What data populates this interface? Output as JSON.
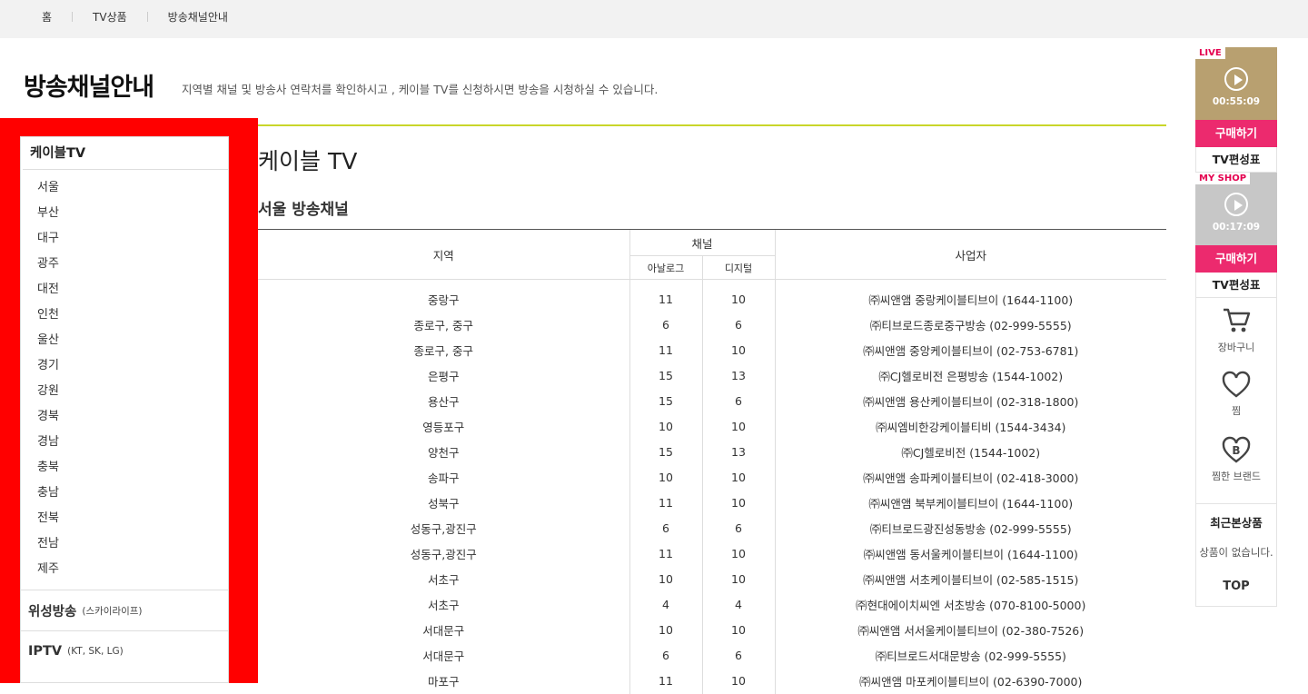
{
  "breadcrumb": [
    "홈",
    "TV상품",
    "방송채널안내"
  ],
  "page": {
    "title": "방송채널안내",
    "description": "지역별 채널 및 방송사 연락처를 확인하시고 , 케이블 TV를 신청하시면 방송을 시청하실 수 있습니다.",
    "main_heading": "케이블 TV",
    "sub_heading": "서울 방송채널"
  },
  "left_nav": {
    "cable_title": "케이블TV",
    "regions": [
      "서울",
      "부산",
      "대구",
      "광주",
      "대전",
      "인천",
      "울산",
      "경기",
      "강원",
      "경북",
      "경남",
      "충북",
      "충남",
      "전북",
      "전남",
      "제주"
    ],
    "satellite": {
      "label": "위성방송",
      "sub": "(스카이라이프)"
    },
    "iptv": {
      "label": "IPTV",
      "sub": "(KT, SK, LG)"
    }
  },
  "table": {
    "headers": {
      "region": "지역",
      "channel": "채널",
      "analog": "아날로그",
      "digital": "디지털",
      "operator": "사업자"
    },
    "rows": [
      [
        "중랑구",
        "11",
        "10",
        "㈜씨앤앰 중랑케이블티브이 (1644-1100)"
      ],
      [
        "종로구, 중구",
        "6",
        "6",
        "㈜티브로드종로중구방송 (02-999-5555)"
      ],
      [
        "종로구, 중구",
        "11",
        "10",
        "㈜씨앤앰 중앙케이블티브이 (02-753-6781)"
      ],
      [
        "은평구",
        "15",
        "13",
        "㈜CJ헬로비전 은평방송 (1544-1002)"
      ],
      [
        "용산구",
        "15",
        "6",
        "㈜씨앤앰 용산케이블티브이 (02-318-1800)"
      ],
      [
        "영등포구",
        "10",
        "10",
        "㈜씨엠비한강케이블티비 (1544-3434)"
      ],
      [
        "양천구",
        "15",
        "13",
        "㈜CJ헬로비전 (1544-1002)"
      ],
      [
        "송파구",
        "10",
        "10",
        "㈜씨앤앰 송파케이블티브이 (02-418-3000)"
      ],
      [
        "성북구",
        "11",
        "10",
        "㈜씨앤앰 북부케이블티브이 (1644-1100)"
      ],
      [
        "성동구,광진구",
        "6",
        "6",
        "㈜티브로드광진성동방송 (02-999-5555)"
      ],
      [
        "성동구,광진구",
        "11",
        "10",
        "㈜씨앤앰 동서울케이블티브이 (1644-1100)"
      ],
      [
        "서초구",
        "10",
        "10",
        "㈜씨앤앰 서초케이블티브이 (02-585-1515)"
      ],
      [
        "서초구",
        "4",
        "4",
        "㈜현대에이치씨엔 서초방송 (070-8100-5000)"
      ],
      [
        "서대문구",
        "10",
        "10",
        "㈜씨앤앰 서서울케이블티브이 (02-380-7526)"
      ],
      [
        "서대문구",
        "6",
        "6",
        "㈜티브로드서대문방송 (02-999-5555)"
      ],
      [
        "마포구",
        "11",
        "10",
        "㈜씨앤앰 마포케이블티브이 (02-6390-7000)"
      ]
    ]
  },
  "right_rail": {
    "live": {
      "tag": "LIVE",
      "time": "00:55:09",
      "buy": "구매하기",
      "schedule": "TV편성표"
    },
    "myshop": {
      "tag": "MY SHOP",
      "time": "00:17:09",
      "buy": "구매하기",
      "schedule": "TV편성표"
    },
    "cart": "장바구니",
    "wish": "찜",
    "wish_brand": "찜한 브랜드",
    "recent_title": "최근본상품",
    "recent_empty": "상품이 없습니다.",
    "top": "TOP"
  }
}
